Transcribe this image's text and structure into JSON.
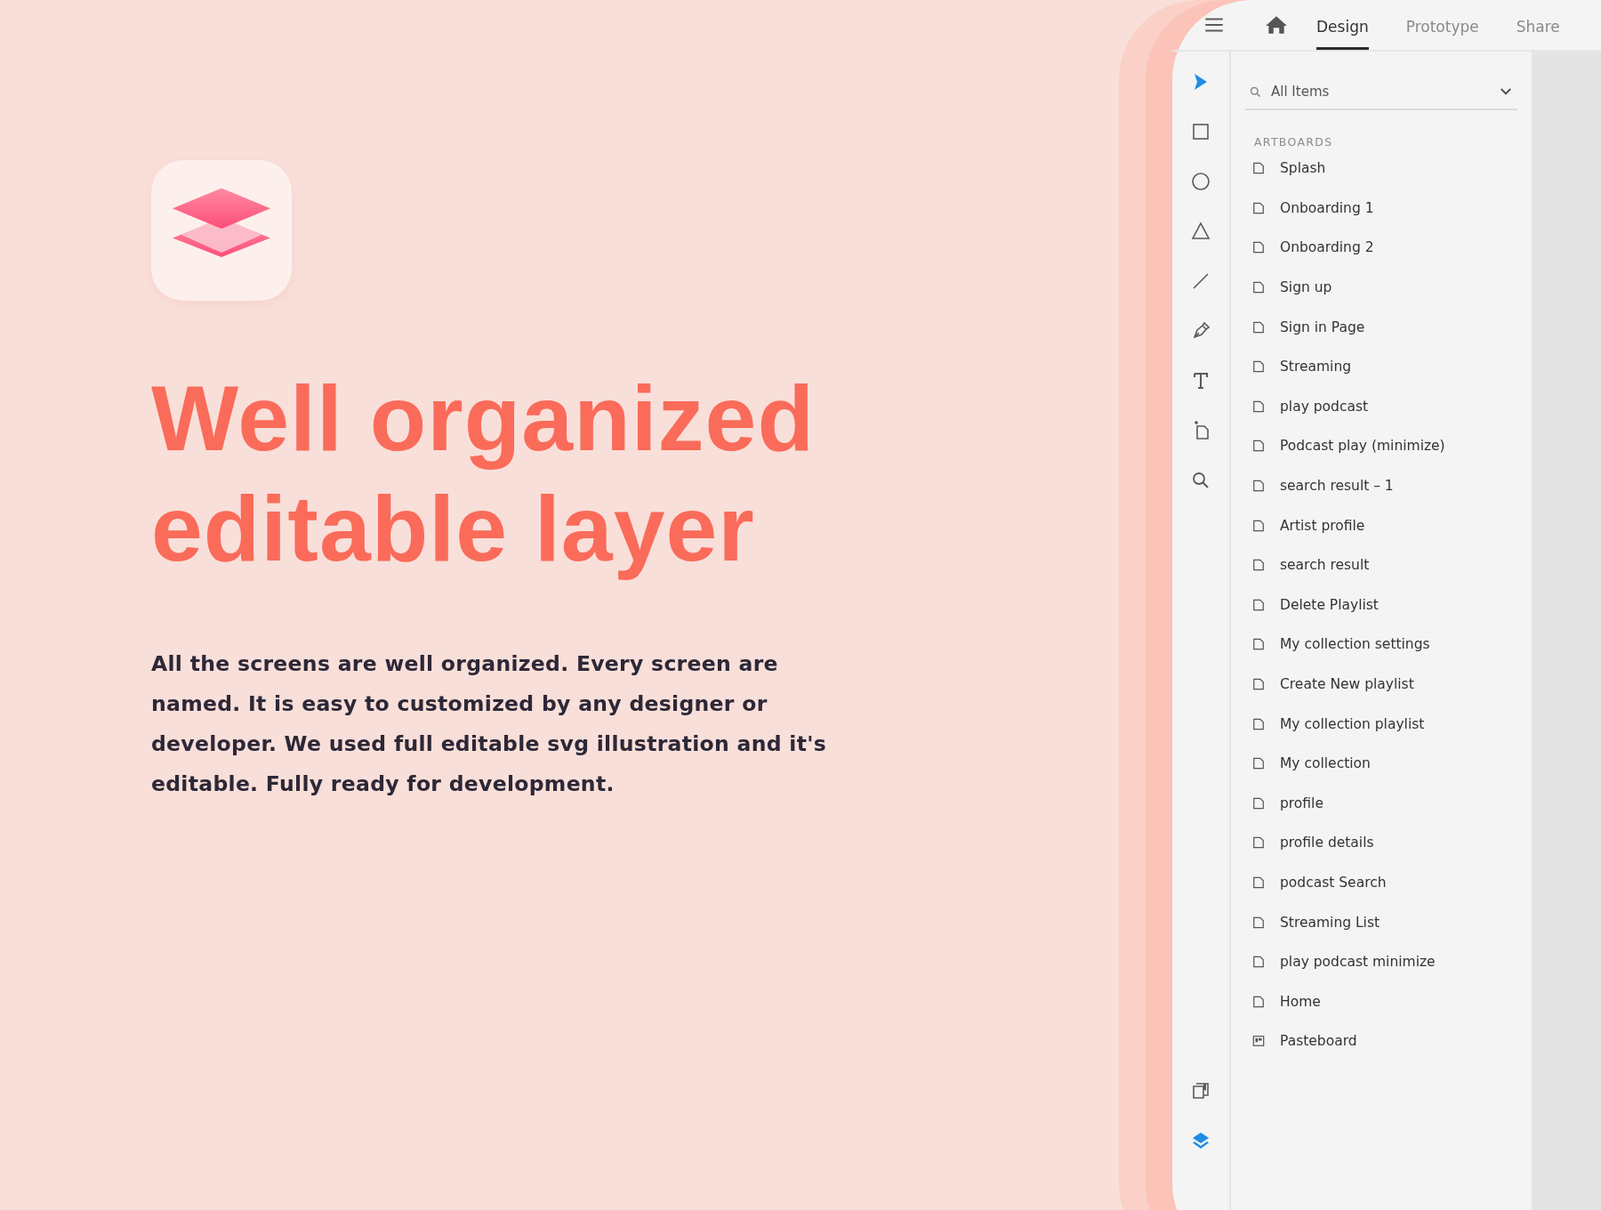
{
  "headline": [
    "Well organized",
    "editable layer"
  ],
  "description": "All the screens are well organized. Every screen are named. It is easy to customized by any designer or developer. We used full editable svg illustration and it's editable. Fully ready for development.",
  "app": {
    "tabs": [
      {
        "label": "Design",
        "selected": true
      },
      {
        "label": "Prototype",
        "selected": false
      },
      {
        "label": "Share",
        "selected": false
      }
    ],
    "tools": [
      {
        "kind": "select",
        "selected": true
      },
      {
        "kind": "rectangle",
        "selected": false
      },
      {
        "kind": "ellipse",
        "selected": false
      },
      {
        "kind": "triangle",
        "selected": false
      },
      {
        "kind": "line",
        "selected": false
      },
      {
        "kind": "pen",
        "selected": false
      },
      {
        "kind": "text",
        "selected": false
      },
      {
        "kind": "artboard",
        "selected": false
      },
      {
        "kind": "zoom",
        "selected": false
      }
    ],
    "bottom_tools": [
      {
        "kind": "assets",
        "selected": false
      },
      {
        "kind": "layers",
        "selected": true
      }
    ],
    "filter": {
      "value": "All Items"
    },
    "section": "ARTBOARDS",
    "items": [
      {
        "label": "Splash",
        "kind": "artboard"
      },
      {
        "label": "Onboarding 1",
        "kind": "artboard"
      },
      {
        "label": "Onboarding 2",
        "kind": "artboard"
      },
      {
        "label": "Sign up",
        "kind": "artboard"
      },
      {
        "label": "Sign in Page",
        "kind": "artboard"
      },
      {
        "label": "Streaming",
        "kind": "artboard"
      },
      {
        "label": "play podcast",
        "kind": "artboard"
      },
      {
        "label": "Podcast play (minimize)",
        "kind": "artboard"
      },
      {
        "label": "search result – 1",
        "kind": "artboard"
      },
      {
        "label": "Artist profile",
        "kind": "artboard"
      },
      {
        "label": "search result",
        "kind": "artboard"
      },
      {
        "label": "Delete Playlist",
        "kind": "artboard"
      },
      {
        "label": "My collection settings",
        "kind": "artboard"
      },
      {
        "label": "Create New playlist",
        "kind": "artboard"
      },
      {
        "label": "My collection playlist",
        "kind": "artboard"
      },
      {
        "label": "My collection",
        "kind": "artboard"
      },
      {
        "label": "profile",
        "kind": "artboard"
      },
      {
        "label": "profile details",
        "kind": "artboard"
      },
      {
        "label": "podcast Search",
        "kind": "artboard"
      },
      {
        "label": "Streaming List",
        "kind": "artboard"
      },
      {
        "label": "play podcast minimize",
        "kind": "artboard"
      },
      {
        "label": "Home",
        "kind": "artboard"
      },
      {
        "label": "Pasteboard",
        "kind": "pasteboard"
      }
    ]
  }
}
